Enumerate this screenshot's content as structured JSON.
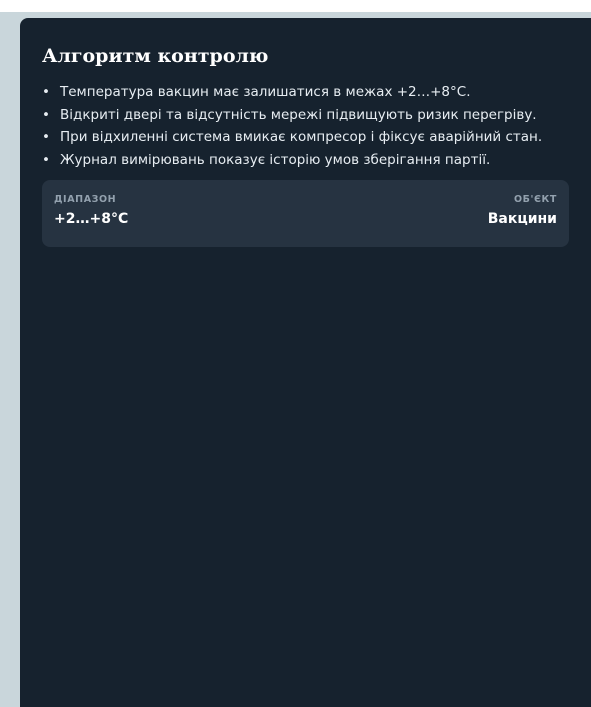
{
  "panel": {
    "title": "Алгоритм контролю",
    "items": [
      "Температура вакцин має залишатися в межах +2…+8°C.",
      "Відкриті двері та відсутність мережі підвищують ризик перегріву.",
      "При відхиленні система вмикає компресор і фіксує аварійний стан.",
      "Журнал вимірювань показує історію умов зберігання партії."
    ],
    "info": {
      "range_label": "ДІАПАЗОН",
      "range_value": "+2…+8°C",
      "object_label": "ОБ'ЄКТ",
      "object_value": "Вакцини"
    }
  },
  "colors": {
    "panel_bg": "#16222e",
    "card_bg": "#263341",
    "page_bg": "#c9d6db"
  }
}
